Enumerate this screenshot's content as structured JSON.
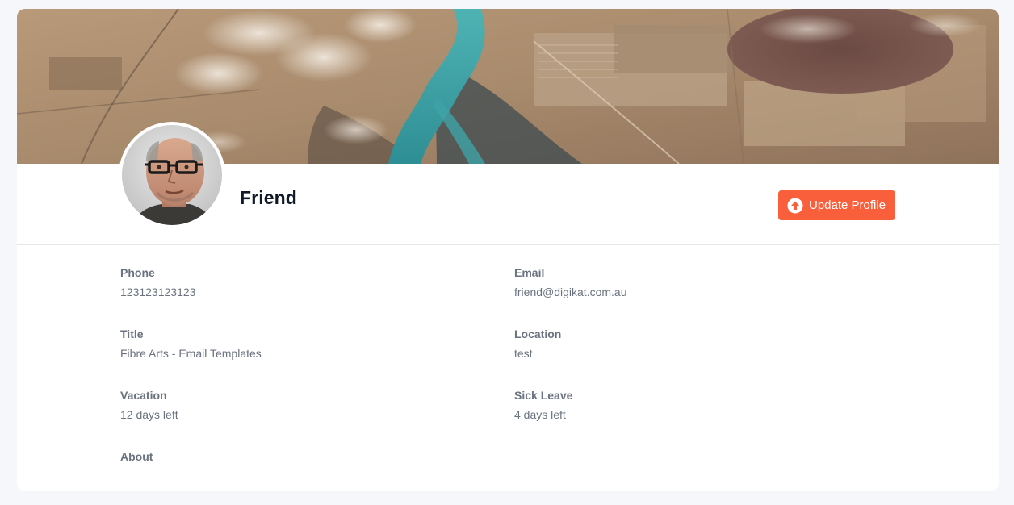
{
  "profile": {
    "name": "Friend",
    "update_button_label": "Update Profile"
  },
  "fields": {
    "phone": {
      "label": "Phone",
      "value": "123123123123"
    },
    "email": {
      "label": "Email",
      "value": "friend@digikat.com.au"
    },
    "title": {
      "label": "Title",
      "value": "Fibre Arts - Email Templates"
    },
    "location": {
      "label": "Location",
      "value": "test"
    },
    "vacation": {
      "label": "Vacation",
      "value": "12 days left"
    },
    "sick_leave": {
      "label": "Sick Leave",
      "value": "4 days left"
    },
    "about": {
      "label": "About",
      "value": ""
    }
  },
  "icons": {
    "update": "arrow-up-circle-icon"
  },
  "colors": {
    "accent": "#fa5f3c",
    "page_background": "#f6f7fb",
    "card_background": "#ffffff",
    "heading_text": "#111827",
    "muted_text": "#6b7280"
  }
}
